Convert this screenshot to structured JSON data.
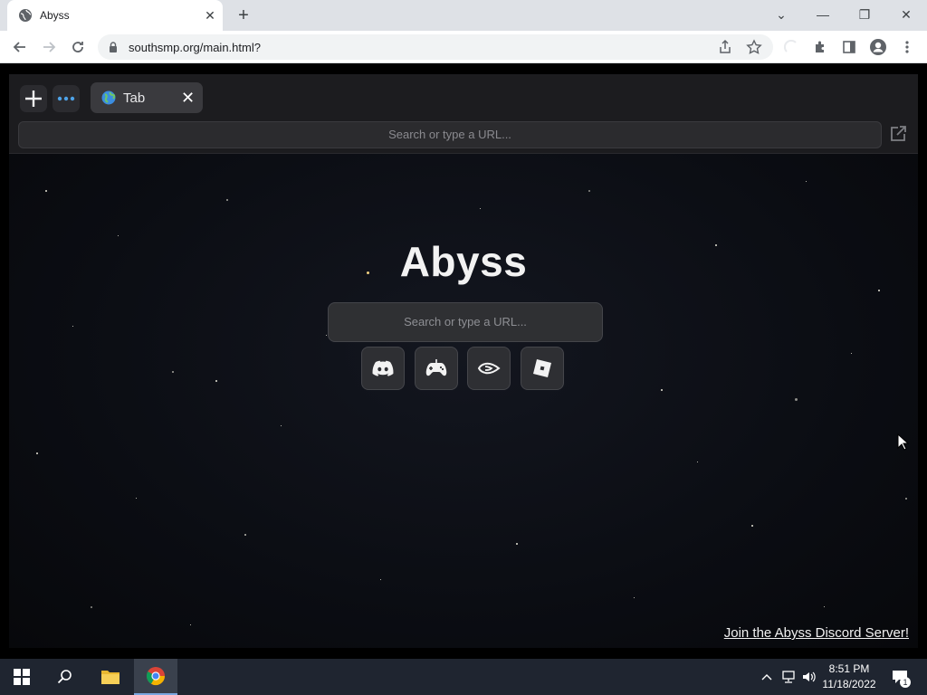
{
  "browser": {
    "tab_title": "Abyss",
    "url": "southsmp.org/main.html?"
  },
  "abyss": {
    "tab_label": "Tab",
    "url_placeholder": "Search or type a URL...",
    "brand": "Abyss",
    "search_placeholder": "Search or type a URL...",
    "shortcuts": [
      "discord-icon",
      "gamepad-icon",
      "nvidia-icon",
      "roblox-icon"
    ],
    "discord_link": "Join the Abyss Discord Server!"
  },
  "taskbar": {
    "time": "8:51 PM",
    "date": "11/18/2022",
    "notification_count": "1"
  },
  "colors": {
    "accent": "#7aa7e0",
    "page_bg": "#0d0e12"
  }
}
